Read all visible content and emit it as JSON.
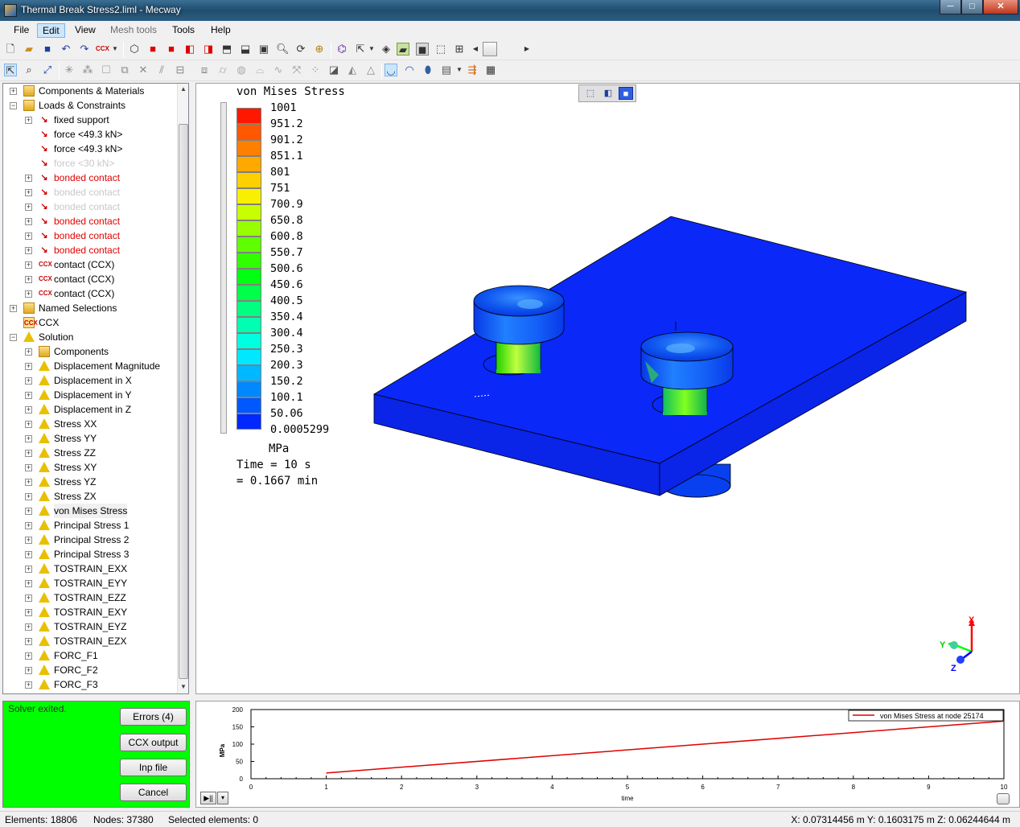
{
  "window": {
    "title": "Thermal Break Stress2.liml - Mecway",
    "minimize": "─",
    "maximize": "□",
    "close": "✕"
  },
  "menu": [
    {
      "label": "File",
      "state": "normal"
    },
    {
      "label": "Edit",
      "state": "active"
    },
    {
      "label": "View",
      "state": "normal"
    },
    {
      "label": "Mesh tools",
      "state": "disabled"
    },
    {
      "label": "Tools",
      "state": "normal"
    },
    {
      "label": "Help",
      "state": "normal"
    }
  ],
  "toolbar1_icons": [
    "new-file",
    "open-folder",
    "save",
    "undo",
    "redo",
    "ccx-solve",
    "dropdown",
    "view-iso",
    "view-front-red",
    "view-back-red",
    "view-left-red",
    "view-right-red",
    "view-top",
    "view-bottom",
    "zoom",
    "rotate",
    "zoom-fit",
    "select-node",
    "node-cursor",
    "show-edges",
    "show-surface",
    "show-solid",
    "show-wireframe",
    "mesh-grid",
    "scroll-left",
    "slider",
    "scroll-right"
  ],
  "toolbar2_icons": [
    "select-pointer",
    "select-node",
    "select-element",
    "explode",
    "mirror",
    "box",
    "extrude",
    "close-x",
    "split",
    "refine",
    "merge",
    "cylinder",
    "revolve",
    "sweep",
    "smooth",
    "scale",
    "renumber",
    "wedge",
    "triangle",
    "shell-view-1",
    "shell-view-2",
    "shell-view-3",
    "film",
    "arrows",
    "table"
  ],
  "tree": [
    {
      "label": "Components & Materials",
      "level": 0,
      "icon": "folder",
      "expander": "+",
      "color": "normal"
    },
    {
      "label": "Loads & Constraints",
      "level": 0,
      "icon": "folder",
      "expander": "−",
      "color": "normal"
    },
    {
      "label": "fixed support",
      "level": 1,
      "icon": "load",
      "expander": "+",
      "color": "normal"
    },
    {
      "label": "force <49.3 kN>",
      "level": 1,
      "icon": "load",
      "expander": "",
      "color": "normal"
    },
    {
      "label": "force <49.3 kN>",
      "level": 1,
      "icon": "load",
      "expander": "",
      "color": "normal"
    },
    {
      "label": "force <30 kN>",
      "level": 1,
      "icon": "load",
      "expander": "",
      "color": "grey"
    },
    {
      "label": "bonded contact",
      "level": 1,
      "icon": "load",
      "expander": "+",
      "color": "red"
    },
    {
      "label": "bonded contact",
      "level": 1,
      "icon": "load",
      "expander": "+",
      "color": "grey"
    },
    {
      "label": "bonded contact",
      "level": 1,
      "icon": "load",
      "expander": "+",
      "color": "grey"
    },
    {
      "label": "bonded contact",
      "level": 1,
      "icon": "load",
      "expander": "+",
      "color": "red"
    },
    {
      "label": "bonded contact",
      "level": 1,
      "icon": "load",
      "expander": "+",
      "color": "red"
    },
    {
      "label": "bonded contact",
      "level": 1,
      "icon": "load",
      "expander": "+",
      "color": "red"
    },
    {
      "label": "contact (CCX)",
      "level": 1,
      "icon": "ccx",
      "expander": "+",
      "color": "normal"
    },
    {
      "label": "contact (CCX)",
      "level": 1,
      "icon": "ccx",
      "expander": "+",
      "color": "normal"
    },
    {
      "label": "contact (CCX)",
      "level": 1,
      "icon": "ccx",
      "expander": "+",
      "color": "normal"
    },
    {
      "label": "Named Selections",
      "level": 0,
      "icon": "folder",
      "expander": "+",
      "color": "normal"
    },
    {
      "label": "CCX",
      "level": 0,
      "icon": "ccx-box",
      "expander": "",
      "color": "normal"
    },
    {
      "label": "Solution",
      "level": 0,
      "icon": "tri",
      "expander": "−",
      "color": "normal"
    },
    {
      "label": "Components",
      "level": 1,
      "icon": "folder",
      "expander": "+",
      "color": "normal"
    },
    {
      "label": "Displacement Magnitude",
      "level": 1,
      "icon": "tri",
      "expander": "+",
      "color": "normal"
    },
    {
      "label": "Displacement in X",
      "level": 1,
      "icon": "tri",
      "expander": "+",
      "color": "normal"
    },
    {
      "label": "Displacement in Y",
      "level": 1,
      "icon": "tri",
      "expander": "+",
      "color": "normal"
    },
    {
      "label": "Displacement in Z",
      "level": 1,
      "icon": "tri",
      "expander": "+",
      "color": "normal"
    },
    {
      "label": "Stress XX",
      "level": 1,
      "icon": "tri",
      "expander": "+",
      "color": "normal"
    },
    {
      "label": "Stress YY",
      "level": 1,
      "icon": "tri",
      "expander": "+",
      "color": "normal"
    },
    {
      "label": "Stress ZZ",
      "level": 1,
      "icon": "tri",
      "expander": "+",
      "color": "normal"
    },
    {
      "label": "Stress XY",
      "level": 1,
      "icon": "tri",
      "expander": "+",
      "color": "normal"
    },
    {
      "label": "Stress YZ",
      "level": 1,
      "icon": "tri",
      "expander": "+",
      "color": "normal"
    },
    {
      "label": "Stress ZX",
      "level": 1,
      "icon": "tri",
      "expander": "+",
      "color": "normal"
    },
    {
      "label": "von Mises Stress",
      "level": 1,
      "icon": "tri",
      "expander": "+",
      "color": "normal",
      "selected": true
    },
    {
      "label": "Principal Stress 1",
      "level": 1,
      "icon": "tri",
      "expander": "+",
      "color": "normal"
    },
    {
      "label": "Principal Stress 2",
      "level": 1,
      "icon": "tri",
      "expander": "+",
      "color": "normal"
    },
    {
      "label": "Principal Stress 3",
      "level": 1,
      "icon": "tri",
      "expander": "+",
      "color": "normal"
    },
    {
      "label": "TOSTRAIN_EXX",
      "level": 1,
      "icon": "tri",
      "expander": "+",
      "color": "normal"
    },
    {
      "label": "TOSTRAIN_EYY",
      "level": 1,
      "icon": "tri",
      "expander": "+",
      "color": "normal"
    },
    {
      "label": "TOSTRAIN_EZZ",
      "level": 1,
      "icon": "tri",
      "expander": "+",
      "color": "normal"
    },
    {
      "label": "TOSTRAIN_EXY",
      "level": 1,
      "icon": "tri",
      "expander": "+",
      "color": "normal"
    },
    {
      "label": "TOSTRAIN_EYZ",
      "level": 1,
      "icon": "tri",
      "expander": "+",
      "color": "normal"
    },
    {
      "label": "TOSTRAIN_EZX",
      "level": 1,
      "icon": "tri",
      "expander": "+",
      "color": "normal"
    },
    {
      "label": "FORC_F1",
      "level": 1,
      "icon": "tri",
      "expander": "+",
      "color": "normal"
    },
    {
      "label": "FORC_F2",
      "level": 1,
      "icon": "tri",
      "expander": "+",
      "color": "normal"
    },
    {
      "label": "FORC_F3",
      "level": 1,
      "icon": "tri",
      "expander": "+",
      "color": "normal"
    }
  ],
  "legend": {
    "title": "von Mises Stress",
    "values": [
      "1001",
      "951.2",
      "901.2",
      "851.1",
      "801",
      "751",
      "700.9",
      "650.8",
      "600.8",
      "550.7",
      "500.6",
      "450.6",
      "400.5",
      "350.4",
      "300.4",
      "250.3",
      "200.3",
      "150.2",
      "100.1",
      "50.06",
      "0.0005299"
    ],
    "colors": [
      "#ff1800",
      "#ff5800",
      "#ff8000",
      "#ffa800",
      "#ffd000",
      "#f8f000",
      "#c8ff00",
      "#98ff00",
      "#60ff00",
      "#30ff00",
      "#00ff10",
      "#00ff48",
      "#00ff80",
      "#00ffb0",
      "#00ffe0",
      "#00e8ff",
      "#00b8ff",
      "#0088ff",
      "#0058ff",
      "#0028ff"
    ],
    "units": "MPa",
    "time_s": "Time = 10 s",
    "time_min": "= 0.1667 min"
  },
  "axes_triad": {
    "x": "X",
    "y": "Y",
    "z": "Z",
    "x_color": "#ff0000",
    "y_color": "#00ff00",
    "z_color": "#0000ff"
  },
  "status_panel": {
    "status": "Solver exited.",
    "buttons": [
      "Errors (4)",
      "CCX output",
      "Inp file",
      "Cancel"
    ],
    "color": "#00ff00"
  },
  "chart_data": {
    "type": "line",
    "title": "",
    "xlabel": "time",
    "ylabel": "MPa",
    "xlim": [
      0,
      10
    ],
    "ylim": [
      0,
      200
    ],
    "xticks": [
      "0",
      "1",
      "2",
      "3",
      "4",
      "5",
      "6",
      "7",
      "8",
      "9",
      "10"
    ],
    "yticks": [
      "0",
      "50",
      "100",
      "150",
      "200"
    ],
    "legend": "top-right",
    "grid": false,
    "series": [
      {
        "name": "von Mises Stress at node 25174",
        "color": "#e00000",
        "x": [
          1,
          10
        ],
        "y": [
          16.67,
          166.7
        ]
      }
    ]
  },
  "statusbar": {
    "elements": "Elements: 18806",
    "nodes": "Nodes: 37380",
    "selected": "Selected elements: 0",
    "coords": "X: 0.07314456 m Y: 0.1603175 m Z: 0.06244644 m"
  },
  "play_button": "▶||",
  "play_menu": "▾"
}
